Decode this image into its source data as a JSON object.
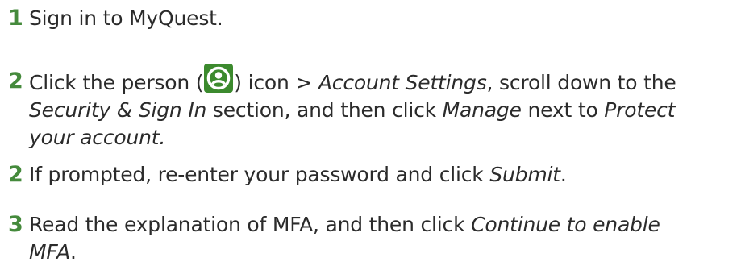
{
  "colors": {
    "step_number": "#458a3c",
    "icon_bg": "#3c8a2e",
    "text": "#2b2b2b"
  },
  "steps": [
    {
      "number": "1",
      "text": "Sign in to MyQuest."
    },
    {
      "number": "2",
      "t1": "Click the person (",
      "icon": "person-icon",
      "t2": ") icon > ",
      "i1": "Account Settings",
      "t3": ", scroll down to the",
      "i2": "Security & Sign In",
      "t4": " section, and then click ",
      "i3": "Manage",
      "t5": " next to ",
      "i4": "Protect",
      "i5": "your account."
    },
    {
      "number": "2",
      "t1": "If prompted, re-enter your password and click ",
      "i1": "Submit",
      "t2": "."
    },
    {
      "number": "3",
      "t1": "Read the explanation of MFA, and then click ",
      "i1": "Continue to enable",
      "i2": "MFA",
      "t2": "."
    }
  ]
}
